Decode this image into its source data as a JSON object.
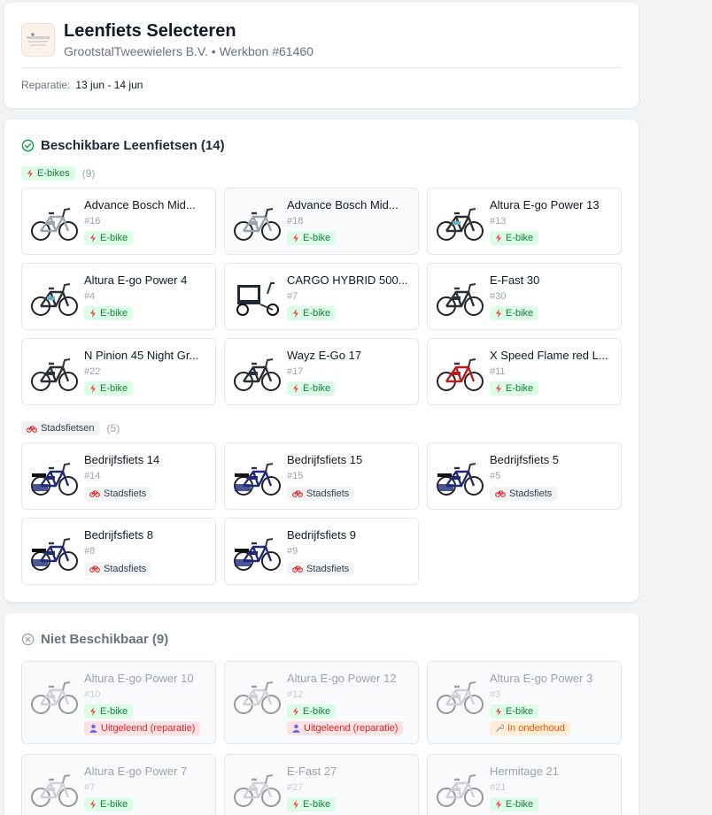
{
  "header": {
    "title": "Leenfiets Selecteren",
    "subtitle": "GrootstalTweewielers B.V. • Werkbon #61460",
    "repair_label": "Reparatie:",
    "repair_dates": "13 jun - 14 jun",
    "logo_icon": "company-logo"
  },
  "available": {
    "title": "Beschikbare Leenfietsen (14)",
    "icon": "check-circle-icon",
    "groups": {
      "ebikes": {
        "label": "E-bikes",
        "count": "(9)",
        "icon": "bolt-icon",
        "items": [
          {
            "name": "Advance Bosch Mid...",
            "num": "#16",
            "tag": "E-bike"
          },
          {
            "name": "Advance Bosch Mid...",
            "num": "#18",
            "tag": "E-bike"
          },
          {
            "name": "Altura E-go Power 13",
            "num": "#13",
            "tag": "E-bike"
          },
          {
            "name": "Altura E-go Power 4",
            "num": "#4",
            "tag": "E-bike"
          },
          {
            "name": "CARGO HYBRID 500...",
            "num": "#7",
            "tag": "E-bike"
          },
          {
            "name": "E-Fast 30",
            "num": "#30",
            "tag": "E-bike"
          },
          {
            "name": "N Pinion 45 Night Gr...",
            "num": "#22",
            "tag": "E-bike"
          },
          {
            "name": "Wayz E-Go 17",
            "num": "#17",
            "tag": "E-bike"
          },
          {
            "name": "X Speed Flame red L...",
            "num": "#11",
            "tag": "E-bike"
          }
        ]
      },
      "city": {
        "label": "Stadsfietsen",
        "count": "(5)",
        "icon": "bicycle-icon",
        "items": [
          {
            "name": "Bedrijfsfiets 14",
            "num": "#14",
            "tag": "Stadsfiets"
          },
          {
            "name": "Bedrijfsfiets 15",
            "num": "#15",
            "tag": "Stadsfiets"
          },
          {
            "name": "Bedrijfsfiets 5",
            "num": "#5",
            "tag": "Stadsfiets"
          },
          {
            "name": "Bedrijfsfiets 8",
            "num": "#8",
            "tag": "Stadsfiets"
          },
          {
            "name": "Bedrijfsfiets 9",
            "num": "#9",
            "tag": "Stadsfiets"
          }
        ]
      }
    }
  },
  "unavailable": {
    "title": "Niet Beschikbaar (9)",
    "icon": "x-circle-icon",
    "items": [
      {
        "name": "Altura E-go Power 10",
        "num": "#10",
        "tag": "E-bike",
        "status": "Uitgeleend (reparatie)",
        "status_type": "loan"
      },
      {
        "name": "Altura E-go Power 12",
        "num": "#12",
        "tag": "E-bike",
        "status": "Uitgeleend (reparatie)",
        "status_type": "loan"
      },
      {
        "name": "Altura E-go Power 3",
        "num": "#3",
        "tag": "E-bike",
        "status": "In onderhoud",
        "status_type": "maint"
      },
      {
        "name": "Altura E-go Power 7",
        "num": "#7",
        "tag": "E-bike"
      },
      {
        "name": "E-Fast 27",
        "num": "#27",
        "tag": "E-bike"
      },
      {
        "name": "Hermitage 21",
        "num": "#21",
        "tag": "E-bike"
      }
    ]
  },
  "colors": {
    "ebike_chip_bg": "#dcfce7",
    "ebike_chip_fg": "#15803d",
    "bolt": "#ef4444",
    "city_frame": "#1e2a78",
    "check_icon": "#16a34a"
  }
}
